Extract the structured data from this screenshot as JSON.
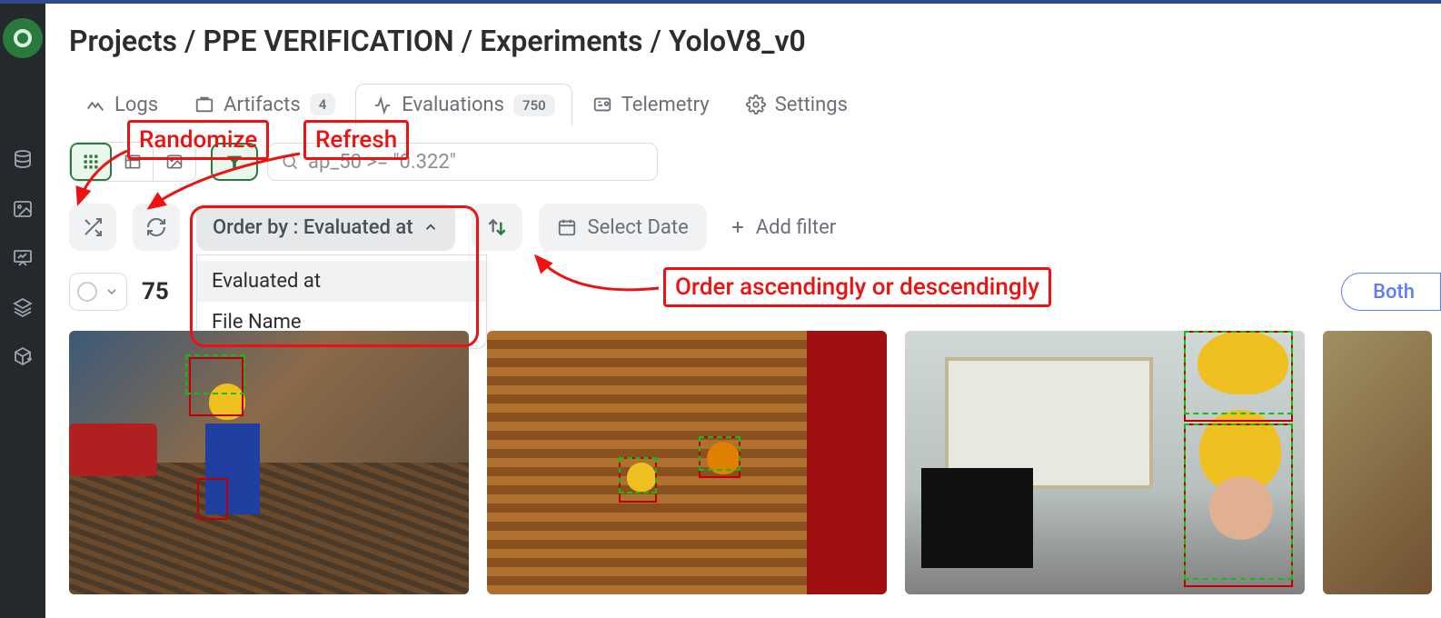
{
  "breadcrumb": {
    "projects": "Projects",
    "project_name": "PPE VERIFICATION",
    "experiments": "Experiments",
    "experiment_name": "YoloV8_v0",
    "sep": "/"
  },
  "tabs": {
    "logs": "Logs",
    "artifacts": "Artifacts",
    "artifacts_count": "4",
    "evaluations": "Evaluations",
    "evaluations_count": "750",
    "telemetry": "Telemetry",
    "settings": "Settings"
  },
  "search": {
    "query": "ap_50 >= \"0.322\""
  },
  "toolbar": {
    "order_by_label": "Order by : Evaluated at",
    "select_date": "Select Date",
    "add_filter": "Add filter"
  },
  "order_dropdown": {
    "options": [
      "Evaluated at",
      "File Name"
    ]
  },
  "results": {
    "count_partial": "75"
  },
  "buttons": {
    "both": "Both"
  },
  "annotations": {
    "randomize": "Randomize",
    "refresh": "Refresh",
    "order_dir": "Order ascendingly or descendingly"
  },
  "colors": {
    "accent_green": "#2a7a3e",
    "annotation_red": "#e11",
    "link_blue": "#5c7cff"
  }
}
